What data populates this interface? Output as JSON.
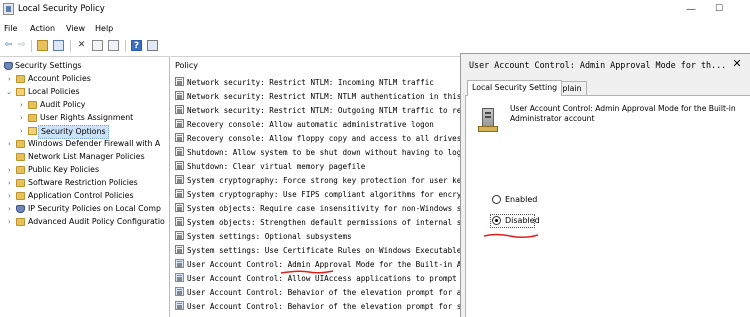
{
  "window": {
    "title": "Local Security Policy",
    "controls": {
      "minimize": "—",
      "maximize": "☐",
      "close": "✕"
    }
  },
  "menu": [
    "File",
    "Action",
    "View",
    "Help"
  ],
  "toolbar": {
    "icons": [
      "back-icon",
      "forward-icon",
      "up-folder-icon",
      "show-hide-tree-icon",
      "delete-icon",
      "properties-icon",
      "export-list-icon",
      "help-icon",
      "mmc-icon"
    ]
  },
  "tree": {
    "items": [
      {
        "label": "Security Settings",
        "arrow": "⌄",
        "icon": "shield"
      },
      {
        "label": "Account Policies",
        "arrow": "›",
        "icon": "folder"
      },
      {
        "label": "Local Policies",
        "arrow": "⌄",
        "icon": "folder-open"
      },
      {
        "label": "Audit Policy",
        "arrow": "›",
        "icon": "folder"
      },
      {
        "label": "User Rights Assignment",
        "arrow": "›",
        "icon": "folder"
      },
      {
        "label": "Security Options",
        "arrow": "›",
        "icon": "folder-open"
      },
      {
        "label": "Windows Defender Firewall with A",
        "arrow": "›",
        "icon": "folder"
      },
      {
        "label": "Network List Manager Policies",
        "arrow": "",
        "icon": "folder"
      },
      {
        "label": "Public Key Policies",
        "arrow": "›",
        "icon": "folder"
      },
      {
        "label": "Software Restriction Policies",
        "arrow": "›",
        "icon": "folder"
      },
      {
        "label": "Application Control Policies",
        "arrow": "›",
        "icon": "folder"
      },
      {
        "label": "IP Security Policies on Local Comp",
        "arrow": "›",
        "icon": "shield"
      },
      {
        "label": "Advanced Audit Policy Configuratio",
        "arrow": "›",
        "icon": "folder"
      }
    ]
  },
  "list": {
    "header": "Policy",
    "rows": [
      "Network security: Restrict NTLM: Incoming NTLM traffic",
      "Network security: Restrict NTLM: NTLM authentication in this d",
      "Network security: Restrict NTLM: Outgoing NTLM traffic to rem",
      "Recovery console: Allow automatic administrative logon",
      "Recovery console: Allow floppy copy and access to all drives and",
      "Shutdown: Allow system to be shut down without having to log on",
      "Shutdown: Clear virtual memory pagefile",
      "System cryptography: Force strong key protection for user keys",
      "System cryptography: Use FIPS compliant algorithms for encrypt",
      "System objects: Require case insensitivity for non-Windows subsy",
      "System objects: Strengthen default permissions of internal syste",
      "System settings: Optional subsystems",
      "System settings: Use Certificate Rules on Windows Executables",
      "User Account Control: Admin Approval Mode for the Built-in Admi",
      "User Account Control: Allow UIAccess applications to prompt fo",
      "User Account Control: Behavior of the elevation prompt for admi",
      "User Account Control: Behavior of the elevation prompt for stand"
    ]
  },
  "dialog": {
    "title": "User Account Control: Admin Approval Mode for th...",
    "close": "✕",
    "tabs": [
      "Local Security Setting",
      "Explain"
    ],
    "description": "User Account Control: Admin Approval Mode for the Built-in Administrator account",
    "options": [
      {
        "label": "Enabled",
        "checked": false
      },
      {
        "label": "Disabled",
        "checked": true
      }
    ]
  },
  "annotation_color": "#e0201b"
}
